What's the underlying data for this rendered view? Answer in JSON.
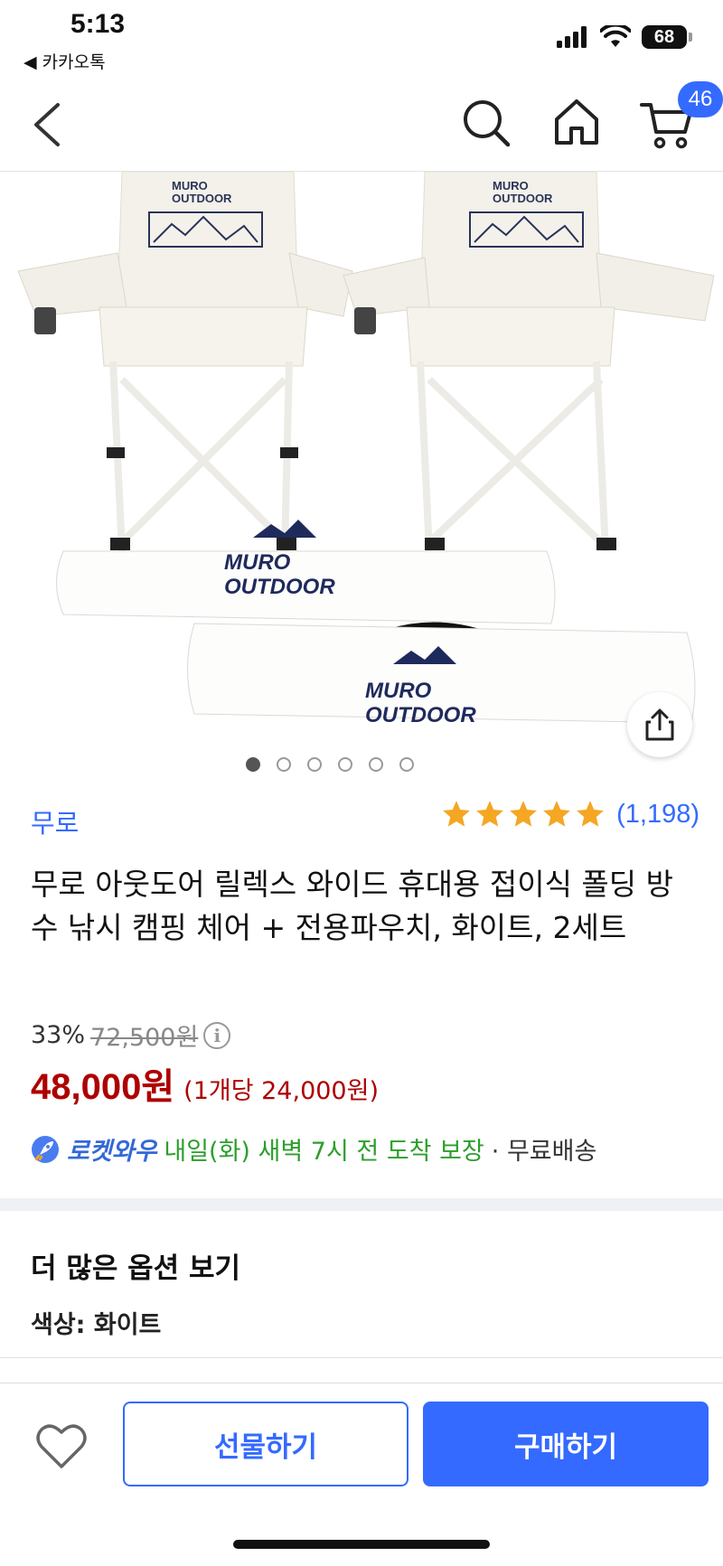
{
  "status_bar": {
    "time": "5:13",
    "back_app": "◀ 카카오톡",
    "battery": "68"
  },
  "nav": {
    "cart_count": "46",
    "icons": [
      "back-arrow-icon",
      "search-icon",
      "home-icon",
      "cart-icon"
    ]
  },
  "product_image": {
    "logo_text_line1": "MURO",
    "logo_text_line2": "OUTDOOR",
    "carousel_total": 6,
    "carousel_active_index": 0
  },
  "product": {
    "brand": "무로",
    "rating": 5,
    "rating_count": "(1,198)",
    "title": "무로 아웃도어 릴렉스 와이드 휴대용 접이식 폴딩 방수 낚시 캠핑 체어 + 전용파우치, 화이트, 2세트",
    "discount_rate": "33%",
    "original_price": "72,500원",
    "sale_price": "48,000원",
    "unit_price": "(1개당 24,000원)"
  },
  "delivery": {
    "rocket_label": "로켓와우",
    "arrival": "내일(화) 새벽 7시 전 도착 보장",
    "shipping": "· 무료배송"
  },
  "options": {
    "section_title": "더 많은 옵션 보기",
    "color": "색상: 화이트"
  },
  "bottom_bar": {
    "gift_label": "선물하기",
    "buy_label": "구매하기"
  },
  "colors": {
    "accent": "#346aff",
    "price": "#ae0000",
    "arrival_green": "#2c9e2c",
    "star": "#f5a623"
  }
}
